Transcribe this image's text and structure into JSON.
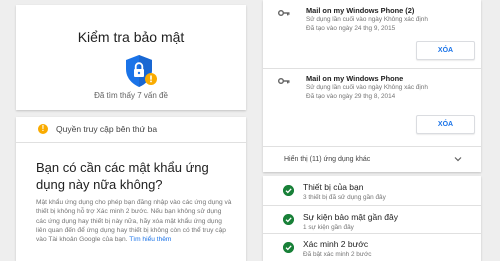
{
  "summary": {
    "title": "Kiểm tra bảo mật",
    "status": "Đã tìm thấy 7 vấn đề",
    "shield_icon": "shield-lock-warning-icon"
  },
  "access": {
    "section_label": "Quyền truy cập bên thứ ba",
    "question": "Bạn có cần các mật khẩu ứng dụng này nữa không?",
    "description": "Mật khẩu ứng dụng cho phép bạn đăng nhập vào các ứng dụng và thiết bị không hỗ trợ Xác minh 2 bước. Nếu bạn không sử dụng các ứng dụng hay thiết bị này nữa, hãy xóa mật khẩu ứng dụng liên quan đến để ứng dụng hay thiết bị không còn có thể truy cập vào Tài khoản Google của bạn.",
    "link": "Tìm hiểu thêm"
  },
  "devices": {
    "items": [
      {
        "name": "Mail on my Windows Phone (2)",
        "last_used": "Sử dụng lần cuối vào ngày Không xác định",
        "created": "Đã tạo vào ngày 24 thg 9, 2015",
        "button": "XÓA"
      },
      {
        "name": "Mail on my Windows Phone",
        "last_used": "Sử dụng lần cuối vào ngày Không xác định",
        "created": "Đã tạo vào ngày 29 thg 8, 2014",
        "button": "XÓA"
      }
    ],
    "show_more": "Hiển thị (11) ứng dụng khác"
  },
  "checks": {
    "items": [
      {
        "label": "Thiết bị của bạn",
        "sub": "3 thiết bị đã sử dụng gần đây"
      },
      {
        "label": "Sự kiện bảo mật gần đây",
        "sub": "1 sự kiện gần đây"
      },
      {
        "label": "Xác minh 2 bước",
        "sub": "Đã bật xác minh 2 bước"
      }
    ]
  },
  "colors": {
    "accent": "#1a73e8",
    "warning": "#f9ab00",
    "ok": "#188038",
    "shield": "#1a73e8"
  }
}
